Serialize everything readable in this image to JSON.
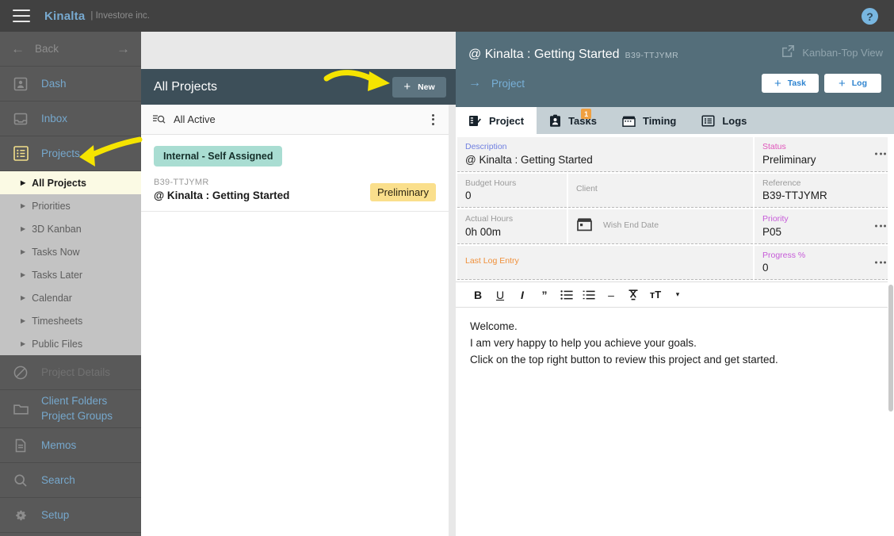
{
  "topbar": {
    "menu_icon": "hamburger-icon",
    "brand": "Kinalta",
    "brand_sub": "| Investore inc.",
    "help_icon": "?"
  },
  "sidebar": {
    "back": {
      "label": "Back",
      "left_icon": "arrow-left-icon",
      "right_icon": "arrow-right-icon"
    },
    "items": [
      {
        "label": "Dash",
        "icon": "user-card-icon"
      },
      {
        "label": "Inbox",
        "icon": "inbox-icon"
      },
      {
        "label": "Projects",
        "icon": "list-table-icon"
      }
    ],
    "sub_items": [
      {
        "label": "All Projects",
        "selected": true
      },
      {
        "label": "Priorities",
        "selected": false
      },
      {
        "label": "3D Kanban",
        "selected": false
      },
      {
        "label": "Tasks Now",
        "selected": false
      },
      {
        "label": "Tasks Later",
        "selected": false
      },
      {
        "label": "Calendar",
        "selected": false
      },
      {
        "label": "Timesheets",
        "selected": false
      },
      {
        "label": "Public Files",
        "selected": false
      }
    ],
    "disabled_item": {
      "label": "Project Details",
      "icon": "blocked-icon"
    },
    "folders_item": {
      "line1": "Client Folders",
      "line2": "Project Groups",
      "icon": "folder-icon"
    },
    "bottom_items": [
      {
        "label": "Memos",
        "icon": "document-icon"
      },
      {
        "label": "Search",
        "icon": "search-icon"
      },
      {
        "label": "Setup",
        "icon": "gear-icon"
      }
    ]
  },
  "middle": {
    "title": "All Projects",
    "new_button": {
      "plus": "+",
      "label": "New"
    },
    "filter": {
      "icon": "filter-search-icon",
      "label": "All Active",
      "menu_icon": "kebab-menu-icon"
    },
    "projects": [
      {
        "group": "Internal - Self Assigned",
        "reference": "B39-TTJYMR",
        "name": "@ Kinalta : Getting Started",
        "status": "Preliminary"
      }
    ]
  },
  "right": {
    "title": "@ Kinalta : Getting Started",
    "reference": "B39-TTJYMR",
    "kanban_link": {
      "icon": "external-link-icon",
      "label": "Kanban-Top View"
    },
    "sub_nav": {
      "arrow": "→",
      "label": "Project"
    },
    "actions": [
      {
        "plus": "+",
        "label": "Task"
      },
      {
        "plus": "+",
        "label": "Log"
      }
    ],
    "tabs": [
      {
        "label": "Project",
        "icon": "checklist-icon",
        "active": true,
        "badge": ""
      },
      {
        "label": "Tasks",
        "icon": "clipboard-person-icon",
        "active": false,
        "badge": "1"
      },
      {
        "label": "Timing",
        "icon": "calendar-icon",
        "active": false,
        "badge": ""
      },
      {
        "label": "Logs",
        "icon": "log-list-icon",
        "active": false,
        "badge": ""
      }
    ],
    "fields": {
      "description": {
        "label": "Description",
        "value": "@ Kinalta : Getting Started"
      },
      "status": {
        "label": "Status",
        "value": "Preliminary"
      },
      "budget_hours": {
        "label": "Budget Hours",
        "value": "0"
      },
      "client": {
        "label": "Client",
        "value": ""
      },
      "reference": {
        "label": "Reference",
        "value": "B39-TTJYMR"
      },
      "actual_hours": {
        "label": "Actual Hours",
        "value": "0h 00m"
      },
      "wish_end_date": {
        "label": "Wish End Date",
        "value": "",
        "icon": "calendar-icon"
      },
      "priority": {
        "label": "Priority",
        "value": "P05"
      },
      "last_log_entry": {
        "label": "Last Log Entry",
        "value": ""
      },
      "progress": {
        "label": "Progress %",
        "value": "0"
      }
    },
    "editor": {
      "toolbar": [
        {
          "glyph": "B",
          "name": "bold-icon"
        },
        {
          "glyph": "U",
          "name": "underline-icon"
        },
        {
          "glyph": "I",
          "name": "italic-icon"
        },
        {
          "glyph": "”",
          "name": "quote-icon"
        },
        {
          "glyph": "☰",
          "name": "bullet-list-icon"
        },
        {
          "glyph": "☷",
          "name": "numbered-list-icon"
        },
        {
          "glyph": "–",
          "name": "horizontal-rule-icon"
        },
        {
          "glyph": "T̶",
          "name": "clear-format-icon"
        },
        {
          "glyph": "тT",
          "name": "font-size-icon"
        },
        {
          "glyph": "▾",
          "name": "chevron-down-icon"
        }
      ],
      "lines": [
        "Welcome.",
        "I am very happy to help you achieve your goals.",
        "Click on the top right button to review this project and get started."
      ]
    }
  },
  "colors": {
    "topbar": "#414141",
    "sidebar": "#595959",
    "sidebar_link": "#76a8cd",
    "mid_header": "#3d4f59",
    "right_header": "#546e7a",
    "tab_bar": "#c5d0d5",
    "group_chip": "#a9ddd2",
    "status_chip": "#fadf8c",
    "badge": "#f0a040",
    "annotation_arrow": "#f5e400"
  }
}
